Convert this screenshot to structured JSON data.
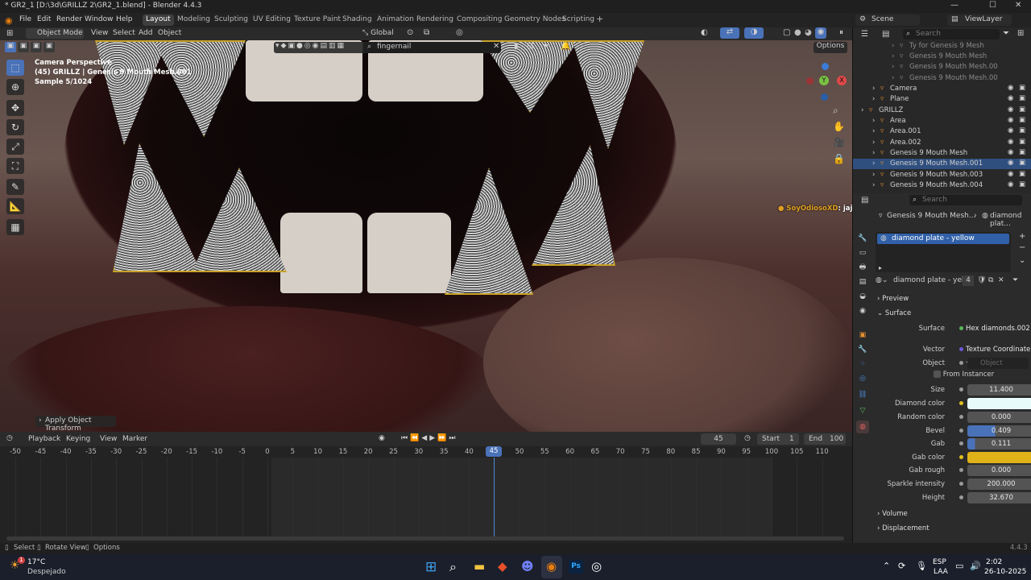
{
  "titlebar": {
    "title": "* GR2_1 [D:\\3d\\GRILLZ 2\\GR2_1.blend] - Blender 4.4.3",
    "minimize": "—",
    "maximize": "☐",
    "close": "✕"
  },
  "menu": {
    "items": [
      "File",
      "Edit",
      "Render",
      "Window",
      "Help"
    ]
  },
  "workspaces": [
    "Layout",
    "Modeling",
    "Sculpting",
    "UV Editing",
    "Texture Paint",
    "Shading",
    "Animation",
    "Rendering",
    "Compositing",
    "Geometry Nodes",
    "Scripting"
  ],
  "scene": {
    "name": "Scene",
    "view_layer": "ViewLayer"
  },
  "viewport_header": {
    "mode": "Object Mode",
    "menus": [
      "View",
      "Select",
      "Add",
      "Object"
    ],
    "transform": "Global",
    "search_value": "fingernail",
    "options": "Options"
  },
  "overlay": {
    "line1": "Camera Perspective",
    "line2": "(45) GRILLZ | Genesis 9 Mouth Mesh.001",
    "line3": "Sample 5/1024"
  },
  "chat_message": {
    "user": "SoyOdiosoXD",
    "text": ": jajajajaja la partida de batlefield fue mas"
  },
  "operator_panel": "Apply Object Transform",
  "outliner": {
    "search_placeholder": "Search",
    "rows": [
      {
        "label": "Ty for Genesis 9 Mesh",
        "dim": true
      },
      {
        "label": "Genesis 9 Mouth Mesh",
        "dim": true
      },
      {
        "label": "Genesis 9 Mouth Mesh.00",
        "dim": true
      },
      {
        "label": "Genesis 9 Mouth Mesh.00",
        "dim": true
      },
      {
        "label": "Camera",
        "dim": false
      },
      {
        "label": "Plane",
        "dim": false
      },
      {
        "label": "GRILLZ",
        "dim": false
      },
      {
        "label": "Area",
        "dim": false
      },
      {
        "label": "Area.001",
        "dim": false
      },
      {
        "label": "Area.002",
        "dim": false
      },
      {
        "label": "Genesis 9 Mouth Mesh",
        "dim": false
      },
      {
        "label": "Genesis 9 Mouth Mesh.001",
        "dim": false,
        "selected": true
      },
      {
        "label": "Genesis 9 Mouth Mesh.003",
        "dim": false
      },
      {
        "label": "Genesis 9 Mouth Mesh.004",
        "dim": false
      }
    ]
  },
  "properties": {
    "search_placeholder": "Search",
    "breadcrumb_object": "Genesis 9 Mouth Mesh...",
    "breadcrumb_material": "diamond plat...",
    "material_slot": "diamond plate - yellow",
    "material_name": "diamond plate - yell...",
    "user_count": "4",
    "sections": {
      "preview": "Preview",
      "surface": "Surface",
      "volume": "Volume",
      "displacement": "Displacement"
    },
    "surface_shader": "Hex diamonds.002",
    "vector_input": "Texture Coordinate | ...",
    "object_placeholder": "Object",
    "from_instancer": "From Instancer",
    "fields": [
      {
        "label": "Surface",
        "value": "Hex diamonds.002"
      },
      {
        "label": "Vector",
        "value": "Texture Coordinate | ..."
      },
      {
        "label": "Object",
        "value": "Object"
      },
      {
        "label": "Size",
        "value": "11.400"
      },
      {
        "label": "Diamond color",
        "value": "",
        "color": "#e8fbfb"
      },
      {
        "label": "Random color",
        "value": "0.000"
      },
      {
        "label": "Bevel",
        "value": "0.409"
      },
      {
        "label": "Gab",
        "value": "0.111"
      },
      {
        "label": "Gab color",
        "value": "",
        "color": "#e0b21a"
      },
      {
        "label": "Gab rough",
        "value": "0.000"
      },
      {
        "label": "Sparkle intensity",
        "value": "200.000"
      },
      {
        "label": "Height",
        "value": "32.670"
      }
    ],
    "bevel_fraction": 0.409,
    "gab_fraction": 0.111
  },
  "timeline": {
    "menus": [
      "Playback",
      "Keying",
      "View",
      "Marker"
    ],
    "current_frame": "45",
    "start_label": "Start",
    "start": "1",
    "end_label": "End",
    "end": "100",
    "ticks": [
      "-50",
      "-45",
      "-40",
      "-35",
      "-30",
      "-25",
      "-20",
      "-15",
      "-10",
      "-5",
      "0",
      "5",
      "10",
      "15",
      "20",
      "25",
      "30",
      "35",
      "40",
      "45",
      "50",
      "55",
      "60",
      "65",
      "70",
      "75",
      "80",
      "85",
      "90",
      "95",
      "100",
      "105",
      "110"
    ]
  },
  "statusbar": {
    "select": "Select",
    "rotate": "Rotate View",
    "options": "Options",
    "version": "4.4.3"
  },
  "taskbar": {
    "temp": "17°C",
    "weather": "Despejado",
    "lang1": "ESP",
    "lang2": "LAA",
    "time": "2:02",
    "date": "26-10-2025",
    "weather_badge": "1"
  }
}
